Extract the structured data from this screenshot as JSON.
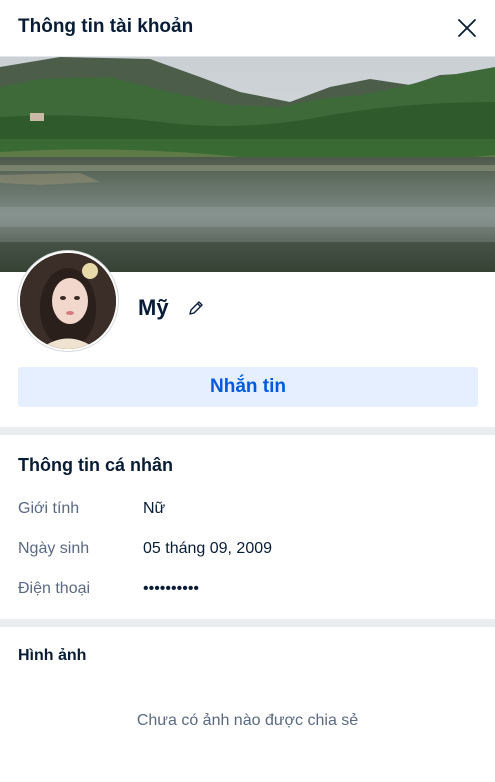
{
  "header": {
    "title": "Thông tin tài khoản",
    "close_icon": "close-icon"
  },
  "profile": {
    "name": "Mỹ",
    "edit_icon": "pencil-icon",
    "message_button": "Nhắn tin"
  },
  "personal_info": {
    "title": "Thông tin cá nhân",
    "rows": [
      {
        "label": "Giới tính",
        "value": "Nữ"
      },
      {
        "label": "Ngày sinh",
        "value": "05 tháng 09, 2009"
      },
      {
        "label": "Điện thoại",
        "value": "••••••••••"
      }
    ]
  },
  "media": {
    "title": "Hình ảnh",
    "empty_text": "Chưa có ảnh nào được chia sẻ"
  },
  "colors": {
    "accent": "#005ae0",
    "button_bg": "#e5efff",
    "text_primary": "#081c36",
    "text_secondary": "#5a6981",
    "divider": "#eaedf0"
  }
}
